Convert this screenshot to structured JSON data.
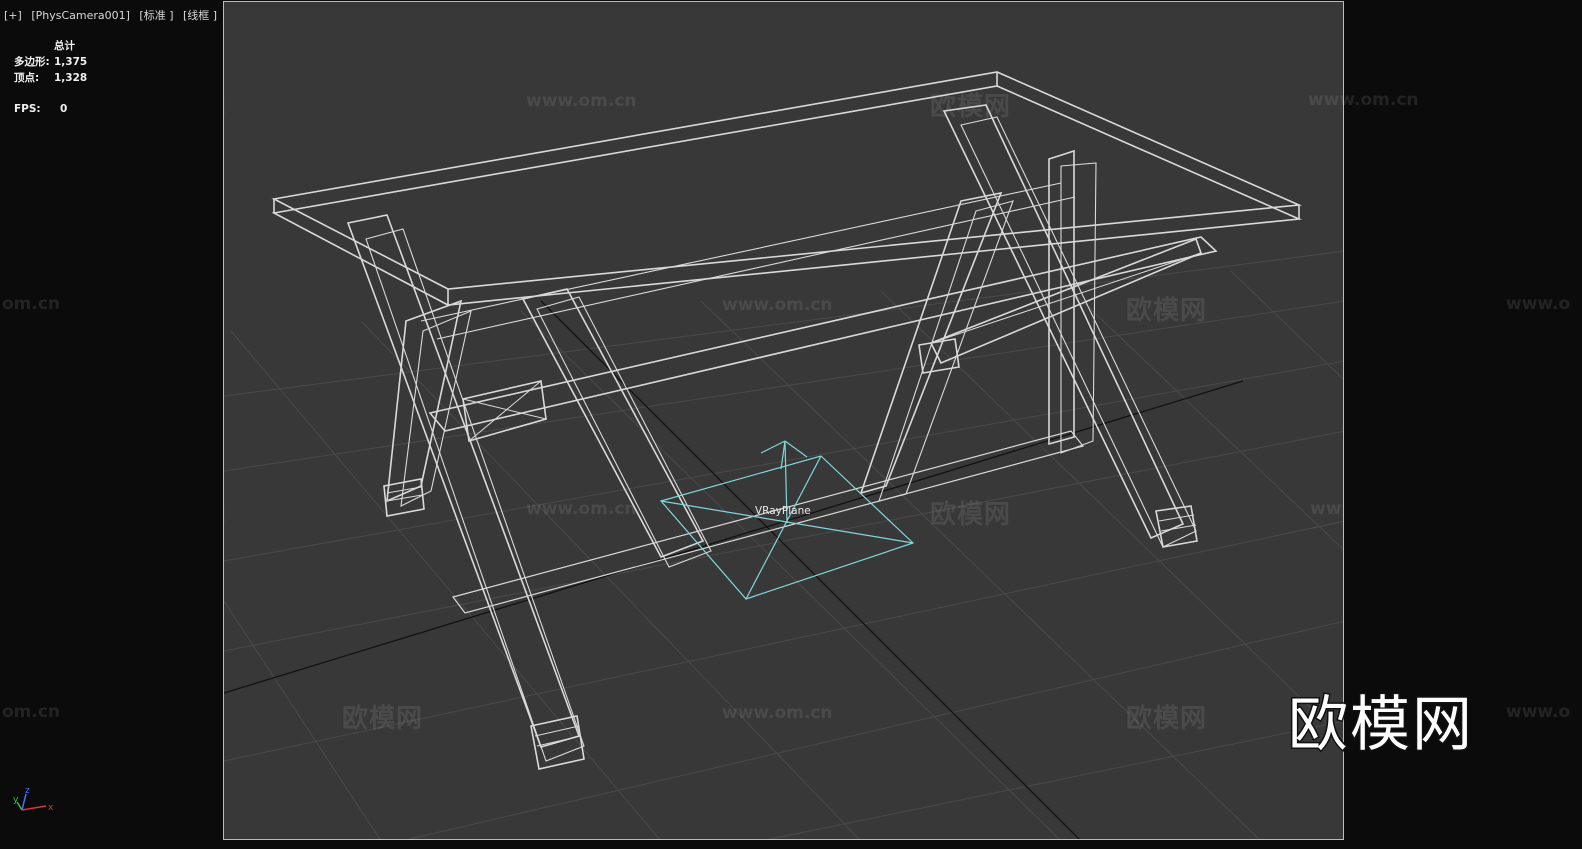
{
  "viewport": {
    "menu_plus": "[+]",
    "camera": "[PhysCamera001]",
    "shading_standard": "[标准 ]",
    "shading_mode": "[线框 ]"
  },
  "stats": {
    "header": "总计",
    "polys_label": "多边形:",
    "polys_value": "1,375",
    "verts_label": "顶点:",
    "verts_value": "1,328",
    "fps_label": "FPS:",
    "fps_value": "0"
  },
  "object_label": "VRayPlane",
  "watermark": {
    "cn": "欧模网",
    "url": "www.om.cn",
    "url_cut": "www.o",
    "cn_cut": "om.cn"
  },
  "axis": {
    "x": "x",
    "y": "y",
    "z": "z"
  },
  "colors": {
    "viewport_border": "#d8d000",
    "wire": "#d9d9d9",
    "vray_plane": "#7fd8dc",
    "grid": "#4a4a4a"
  }
}
